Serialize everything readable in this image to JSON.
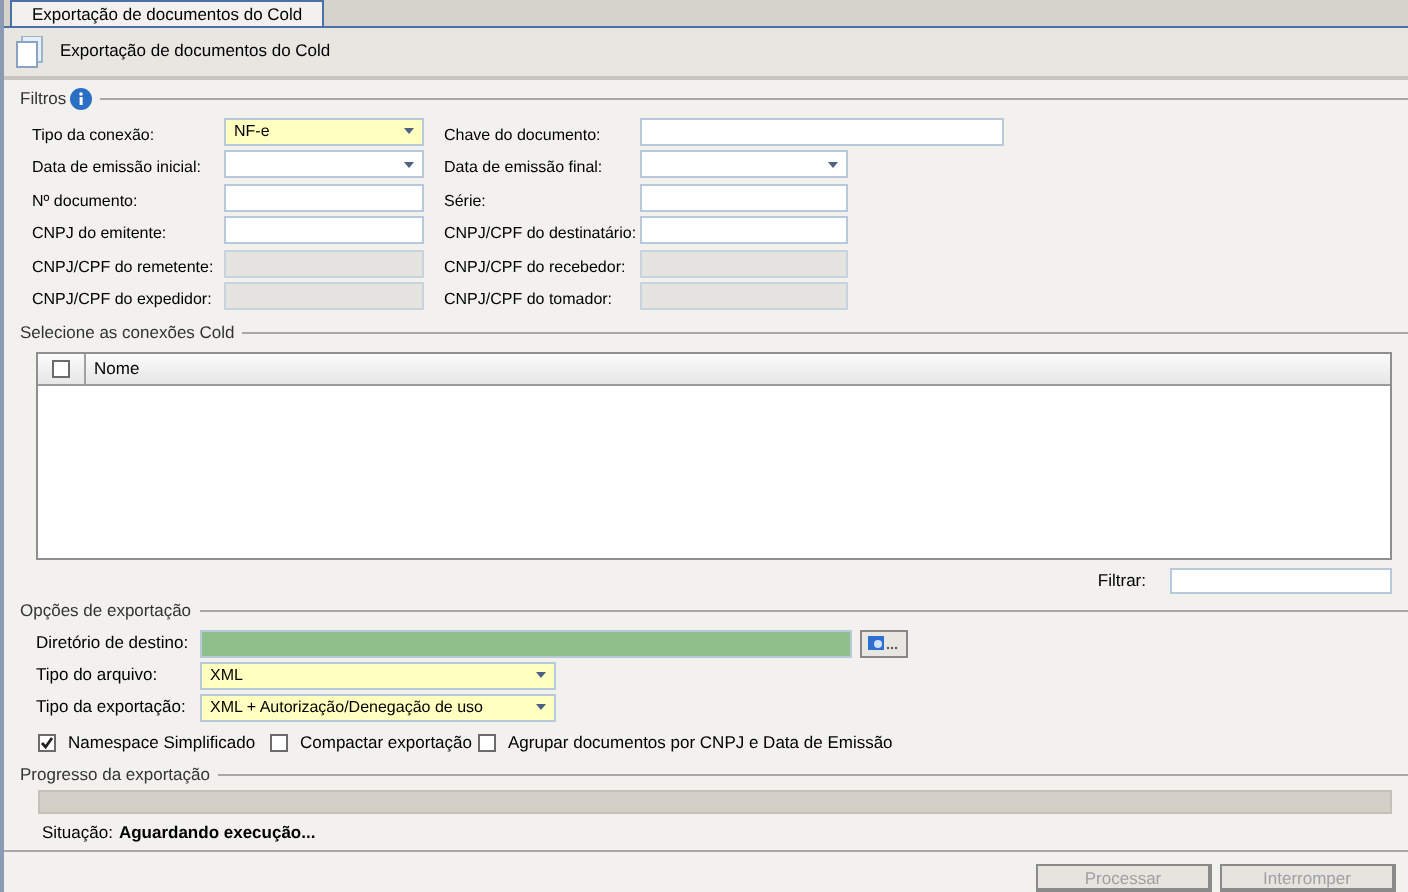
{
  "tab": {
    "label": "Exportação de documentos do Cold",
    "selected": true
  },
  "header": {
    "title": "Exportação de documentos do Cold"
  },
  "filters": {
    "legend": "Filtros",
    "fields": [
      {
        "label": "Tipo da conexão:",
        "kind": "combo",
        "required": true,
        "disabled": false,
        "value": "NF-e"
      },
      {
        "label": "Chave do documento:",
        "kind": "text",
        "required": false,
        "disabled": false
      },
      {
        "label": "Data de emissão inicial:",
        "kind": "combo",
        "required": false,
        "disabled": false
      },
      {
        "label": "Data de emissão final:",
        "kind": "combo",
        "required": false,
        "disabled": false
      },
      {
        "label": "Nº documento:",
        "kind": "text",
        "required": false,
        "disabled": false
      },
      {
        "label": "Série:",
        "kind": "text",
        "required": false,
        "disabled": false
      },
      {
        "label": "CNPJ do emitente:",
        "kind": "text",
        "required": false,
        "disabled": false
      },
      {
        "label": "CNPJ/CPF do destinatário:",
        "kind": "text",
        "required": false,
        "disabled": false
      },
      {
        "label": "CNPJ/CPF do remetente:",
        "kind": "text",
        "required": false,
        "disabled": true
      },
      {
        "label": "CNPJ/CPF do recebedor:",
        "kind": "text",
        "required": false,
        "disabled": true
      },
      {
        "label": "CNPJ/CPF do expedidor:",
        "kind": "text",
        "required": false,
        "disabled": true
      },
      {
        "label": "CNPJ/CPF do tomador:",
        "kind": "text",
        "required": false,
        "disabled": true
      }
    ]
  },
  "connections": {
    "legend": "Selecione as conexões Cold",
    "select_all_checked": false,
    "columns": [
      "Nome"
    ],
    "filter_label": "Filtrar:"
  },
  "export_options": {
    "legend": "Opções de exportação",
    "fields": [
      {
        "label": "Diretório de destino:",
        "kind": "folder",
        "required": false,
        "validated": true
      },
      {
        "label": "Tipo do arquivo:",
        "kind": "combo",
        "required": true,
        "validated": false,
        "value": "XML"
      },
      {
        "label": "Tipo da exportação:",
        "kind": "combo",
        "required": true,
        "validated": false,
        "value": "XML + Autorização/Denegação de uso"
      }
    ],
    "checkboxes": [
      {
        "label": "Namespace Simplificado",
        "checked": true
      },
      {
        "label": "Compactar exportação",
        "checked": false
      },
      {
        "label": "Agrupar documentos por CNPJ e Data de Emissão",
        "checked": false
      }
    ]
  },
  "progress": {
    "legend": "Progresso da exportação",
    "level": 0,
    "status_label": "Situação:",
    "status_value": "Aguardando execução..."
  },
  "buttons": [
    {
      "label": "Processar",
      "disabled": true
    },
    {
      "label": "Interromper",
      "disabled": true
    }
  ]
}
